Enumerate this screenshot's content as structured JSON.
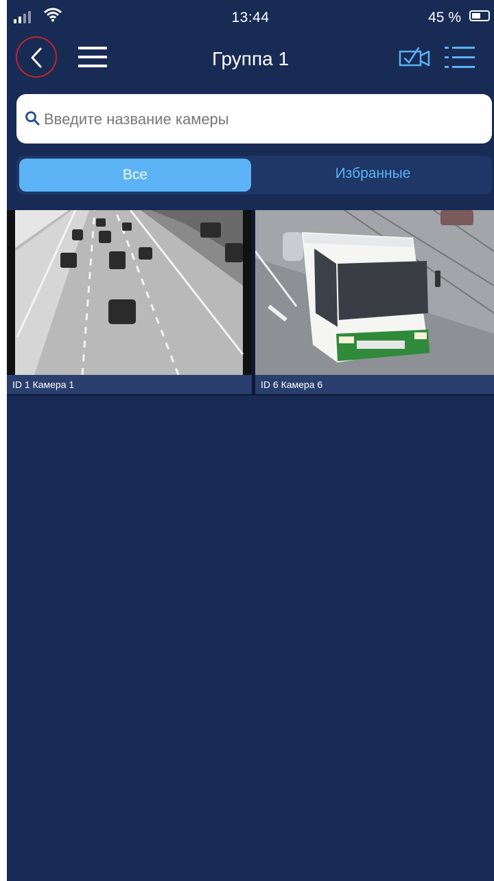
{
  "status_bar": {
    "time": "13:44",
    "battery": "45 %"
  },
  "navbar": {
    "title": "Группа 1",
    "back_icon": "chevron-left-icon",
    "menu_icon": "hamburger-menu-icon",
    "camera_select_icon": "camera-check-icon",
    "list_icon": "list-view-icon"
  },
  "search": {
    "placeholder": "Введите название камеры",
    "value": ""
  },
  "tabs": [
    {
      "label": "Все",
      "active": true
    },
    {
      "label": "Избранные",
      "active": false
    }
  ],
  "cameras": [
    {
      "caption": "ID 1 Камера  1"
    },
    {
      "caption": "ID 6 Камера 6"
    }
  ],
  "colors": {
    "background": "#182b55",
    "accent": "#5bb3f5",
    "back_highlight": "#c0242a"
  }
}
